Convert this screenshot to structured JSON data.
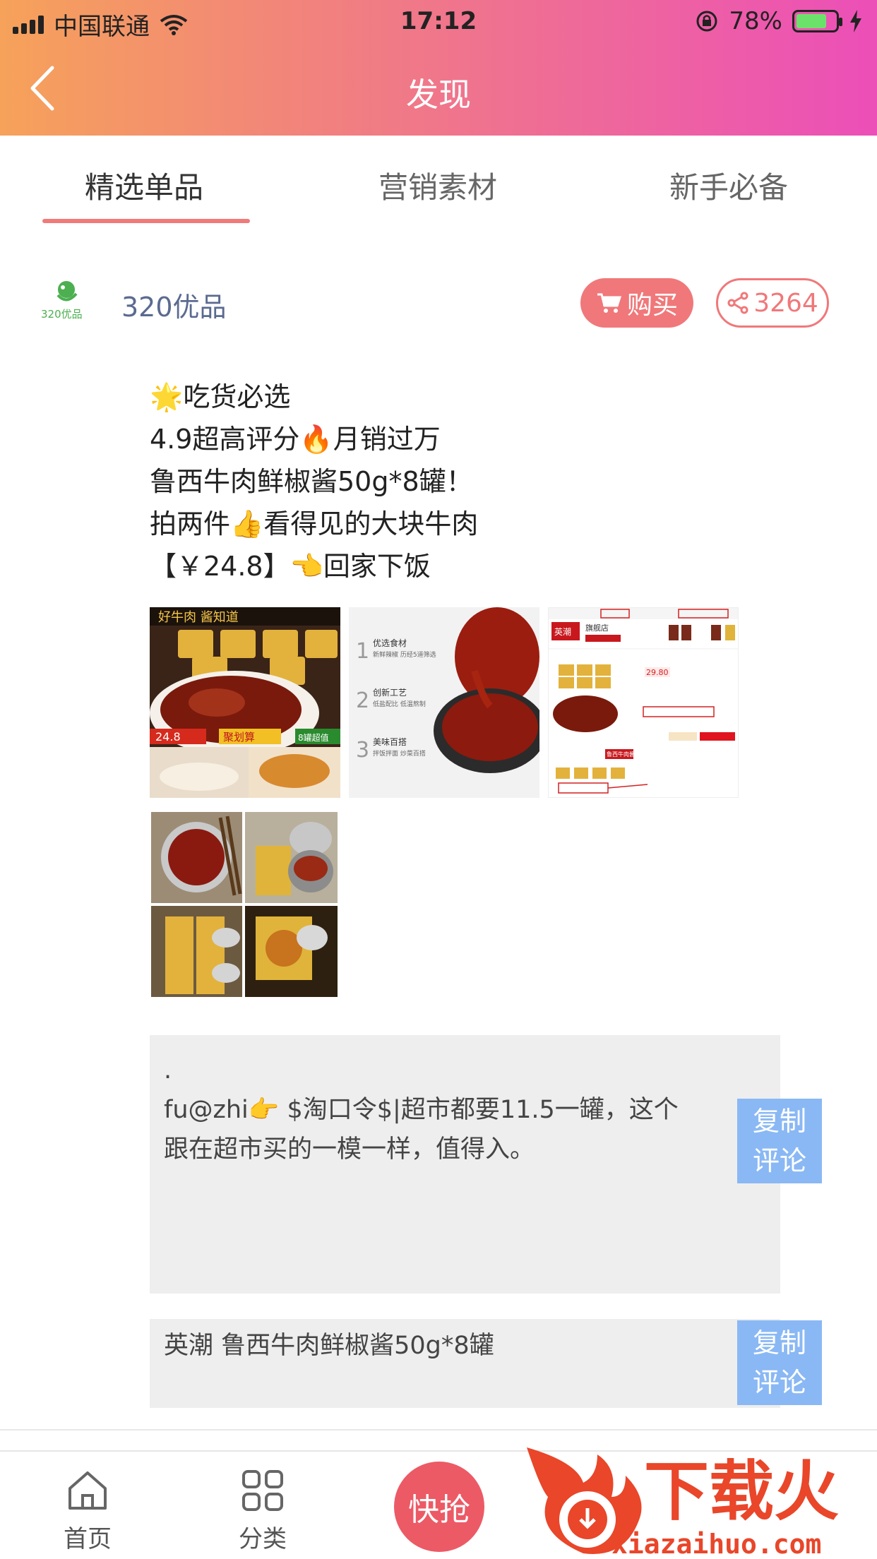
{
  "status_bar": {
    "carrier": "中国联通",
    "time": "17:12",
    "battery": "78%"
  },
  "nav": {
    "title": "发现"
  },
  "tabs": [
    {
      "label": "精选单品",
      "active": true
    },
    {
      "label": "营销素材",
      "active": false
    },
    {
      "label": "新手必备",
      "active": false
    }
  ],
  "store": {
    "logo_text": "320优品",
    "name": "320优品",
    "buy_label": "购买",
    "share_count": "3264"
  },
  "post": {
    "lines": [
      "🌟吃货必选",
      "4.9超高评分🔥月销过万",
      "鲁西牛肉鲜椒酱50g*8罐！",
      "拍两件👍看得见的大块牛肉",
      "【￥24.8】👈回家下饭"
    ]
  },
  "images": {
    "img1": {
      "top_text": "好牛肉 酱知道",
      "price": "24.8",
      "promo": "聚划算",
      "badge": "8罐超值"
    },
    "img2": {
      "items": [
        {
          "num": "1",
          "title": "优选食材",
          "sub": "新鲜辣椒 历经5道筛选"
        },
        {
          "num": "2",
          "title": "创新工艺",
          "sub": "低盐配比 低温熬制"
        },
        {
          "num": "3",
          "title": "美味百搭",
          "sub": "拌饭拌面 炒菜百搭"
        }
      ]
    },
    "img3": {
      "brand": "英潮",
      "store": "旗舰店",
      "price": "29.80",
      "tag": "鲁西牛肉酱"
    }
  },
  "comments": [
    {
      "dot": ".",
      "text": "fu@zhi👉 $淘口令$|超市都要11.5一罐，这个跟在超市买的一模一样，值得入。",
      "button": [
        "复制",
        "评论"
      ]
    },
    {
      "text": "英潮 鲁西牛肉鲜椒酱50g*8罐",
      "button": [
        "复制",
        "评论"
      ]
    }
  ],
  "bottom_nav": {
    "home": "首页",
    "category": "分类",
    "qiang": "快抢"
  },
  "watermark": {
    "brand": "下载火",
    "url": "xiazaihuo.com"
  },
  "colors": {
    "header_gradient_start": "#f6a25a",
    "header_gradient_end": "#ec4fb8",
    "accent": "#f0787a",
    "copy_button": "#8ab8f4",
    "store_name": "#5b6a90"
  }
}
